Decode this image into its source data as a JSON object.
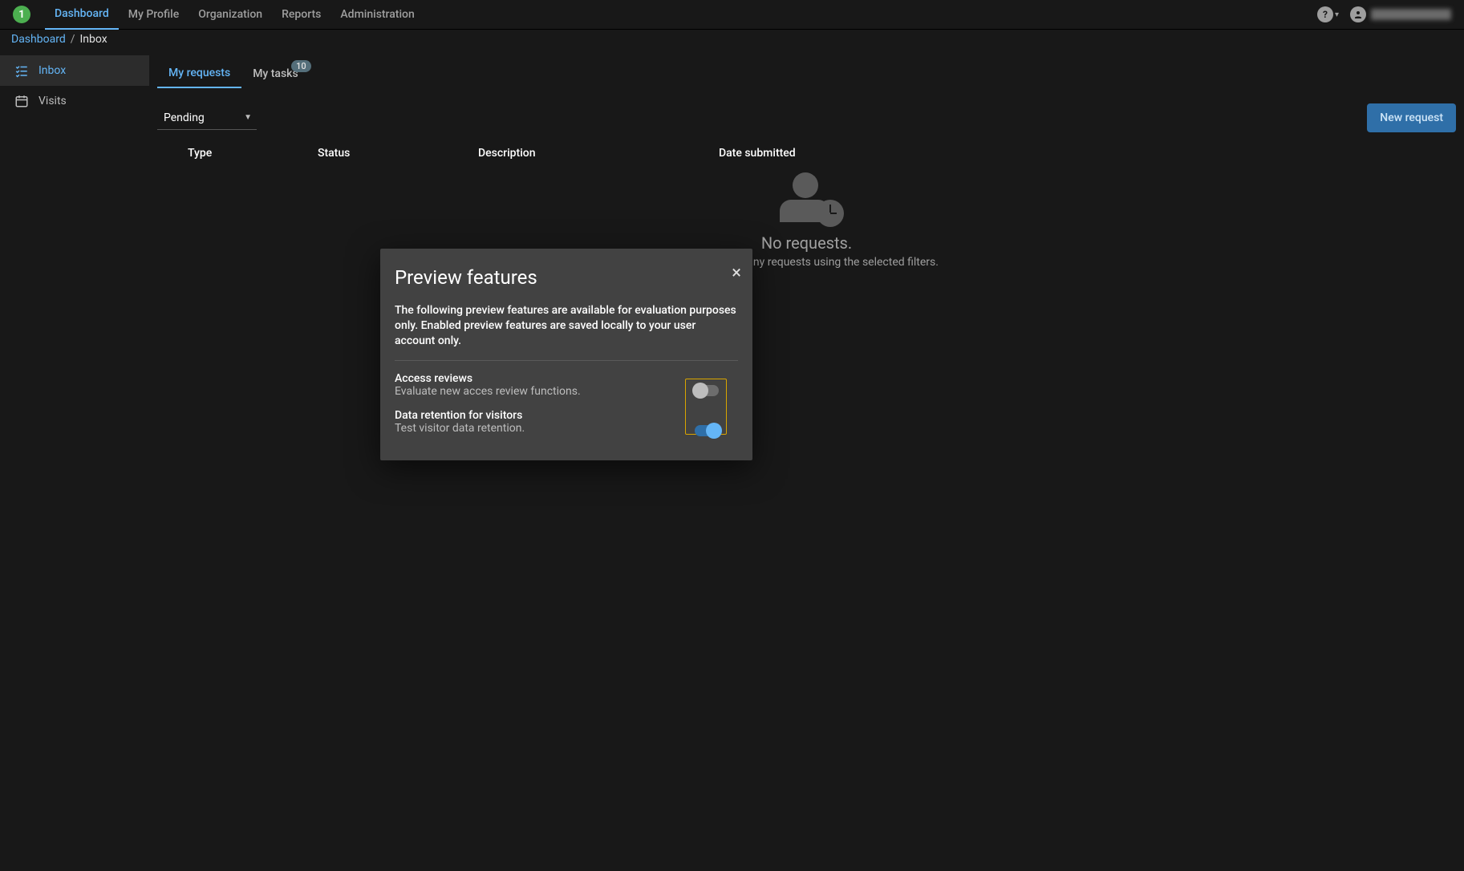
{
  "topnav": {
    "logo_text": "1",
    "items": [
      "Dashboard",
      "My Profile",
      "Organization",
      "Reports",
      "Administration"
    ],
    "active_index": 0
  },
  "breadcrumb": {
    "root": "Dashboard",
    "sep": "/",
    "current": "Inbox"
  },
  "sidebar": {
    "items": [
      {
        "label": "Inbox"
      },
      {
        "label": "Visits"
      }
    ],
    "active_index": 0
  },
  "tabs": {
    "items": [
      {
        "label": "My requests",
        "badge": null
      },
      {
        "label": "My tasks",
        "badge": "10"
      }
    ],
    "active_index": 0
  },
  "filter": {
    "selected": "Pending"
  },
  "buttons": {
    "new_request": "New request"
  },
  "table": {
    "columns": [
      "Type",
      "Status",
      "Description",
      "Date submitted"
    ]
  },
  "empty": {
    "title": "No requests.",
    "subtitle": "Could not find any requests using the selected filters."
  },
  "modal": {
    "title": "Preview features",
    "description": "The following preview features are available for evaluation purposes only. Enabled preview features are saved locally to your user account only.",
    "features": [
      {
        "title": "Access reviews",
        "subtitle": "Evaluate new acces review functions.",
        "on": false
      },
      {
        "title": "Data retention for visitors",
        "subtitle": "Test visitor data retention.",
        "on": true
      }
    ]
  }
}
